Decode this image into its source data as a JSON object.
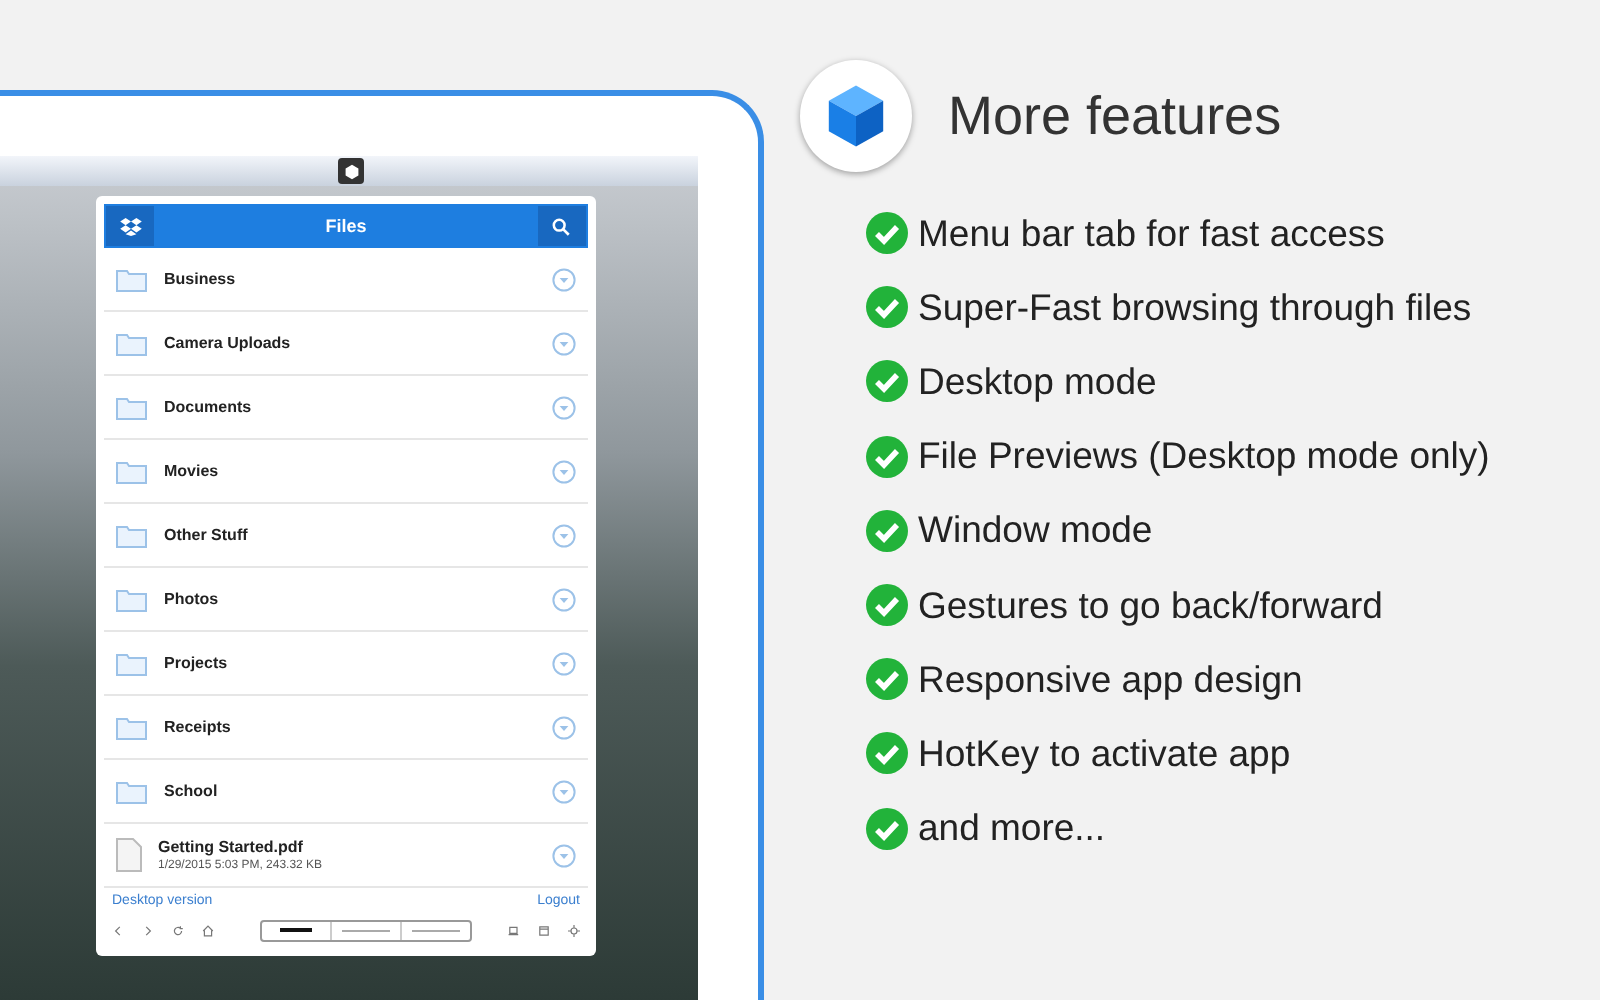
{
  "popup": {
    "title": "Files",
    "items": [
      {
        "kind": "folder",
        "name": "Business"
      },
      {
        "kind": "folder",
        "name": "Camera Uploads"
      },
      {
        "kind": "folder",
        "name": "Documents"
      },
      {
        "kind": "folder",
        "name": "Movies"
      },
      {
        "kind": "folder",
        "name": "Other Stuff"
      },
      {
        "kind": "folder",
        "name": "Photos"
      },
      {
        "kind": "folder",
        "name": "Projects"
      },
      {
        "kind": "folder",
        "name": "Receipts"
      },
      {
        "kind": "folder",
        "name": "School"
      },
      {
        "kind": "file",
        "name": "Getting Started.pdf",
        "details": "1/29/2015 5:03 PM, 243.32 KB"
      }
    ],
    "footer_links": [
      "Desktop version",
      "Logout"
    ],
    "size_segments": [
      {
        "selected": true
      },
      {
        "selected": false
      },
      {
        "selected": false
      }
    ]
  },
  "heading": "More features",
  "features": [
    "Menu bar tab for fast access",
    "Super-Fast browsing through files",
    "Desktop mode",
    "File Previews (Desktop mode only)",
    "Window mode",
    "Gestures to go back/forward",
    "Responsive app design",
    "HotKey to activate app",
    "and more..."
  ]
}
